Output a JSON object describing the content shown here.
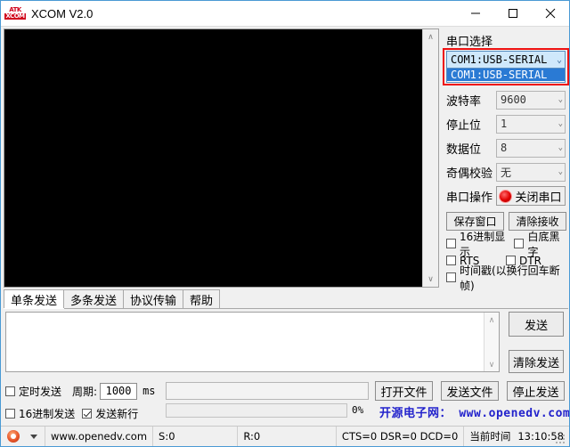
{
  "window": {
    "title": "XCOM V2.0",
    "icon_line1": "ATK",
    "icon_line2": "XCOM",
    "minimize_label": "minimize",
    "maximize_label": "maximize",
    "close_label": "close"
  },
  "receive": {
    "content": "",
    "scroll_up": "∧",
    "scroll_down": "∨"
  },
  "serial_panel": {
    "group_title": "串口选择",
    "port": {
      "selected": "COM1:USB-SERIAL",
      "chevron": "⌄",
      "options": [
        "COM1:USB-SERIAL"
      ],
      "highlight_color": "#ee1111",
      "open": true
    },
    "baud": {
      "label": "波特率",
      "value": "9600",
      "chevron": "⌄"
    },
    "stopbits": {
      "label": "停止位",
      "value": "1",
      "chevron": "⌄"
    },
    "databits": {
      "label": "数据位",
      "value": "8",
      "chevron": "⌄"
    },
    "parity": {
      "label": "奇偶校验",
      "value": "无",
      "chevron": "⌄"
    },
    "operation": {
      "label": "串口操作",
      "button": "关闭串口",
      "led_color": "#e00000"
    },
    "save_window": "保存窗口",
    "clear_receive": "清除接收",
    "checkboxes": [
      {
        "label": "16进制显示",
        "checked": false
      },
      {
        "label": "白底黑字",
        "checked": false
      },
      {
        "label": "RTS",
        "checked": false
      },
      {
        "label": "DTR",
        "checked": false
      },
      {
        "label": "时间戳(以换行回车断帧)",
        "checked": false
      }
    ]
  },
  "tabs": [
    {
      "label": "单条发送",
      "active": true
    },
    {
      "label": "多条发送",
      "active": false
    },
    {
      "label": "协议传输",
      "active": false
    },
    {
      "label": "帮助",
      "active": false
    }
  ],
  "send": {
    "text": "",
    "send_button": "发送",
    "clear_send_button": "清除发送",
    "open_file_button": "打开文件",
    "send_file_button": "发送文件",
    "stop_send_button": "停止发送",
    "scroll_up": "∧",
    "scroll_down": "∨",
    "timed_send": {
      "label": "定时发送",
      "checked": false
    },
    "period_label": "周期:",
    "period_value": "1000",
    "period_unit": "ms",
    "hex_send": {
      "label": "16进制发送",
      "checked": false
    },
    "send_newline": {
      "label": "发送新行",
      "checked": true
    },
    "file_path": "",
    "progress_percent": "0%",
    "progress_value": 0,
    "promo_text": "开源电子网： www.openedv.com",
    "promo_color": "#2222cc"
  },
  "statusbar": {
    "site": "www.openedv.com",
    "sent": "S:0",
    "received": "R:0",
    "signals": "CTS=0 DSR=0 DCD=0",
    "time_label": "当前时间",
    "time_value": "13:10:58"
  }
}
